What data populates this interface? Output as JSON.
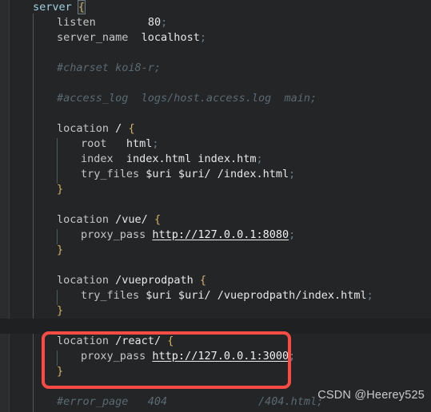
{
  "editor": {
    "background_color": "#232526",
    "highlight_line_color": "#1e2021",
    "comment_color": "#5c6a74",
    "brace_color": "#d4b169",
    "context_color": "#9fd0e0",
    "annotation_box_color": "#fa4b45"
  },
  "code": {
    "language": "nginx",
    "lines": [
      {
        "n": 1,
        "indent": 0,
        "tokens": [
          {
            "t": "ctx",
            "v": "server"
          },
          {
            "t": "sp",
            "v": " "
          },
          {
            "t": "brace-match",
            "v": "{"
          }
        ]
      },
      {
        "n": 2,
        "indent": 1,
        "tokens": [
          {
            "t": "dir",
            "v": "listen"
          },
          {
            "t": "sp",
            "v": "        "
          },
          {
            "t": "val",
            "v": "80"
          },
          {
            "t": "punc",
            "v": ";"
          }
        ]
      },
      {
        "n": 3,
        "indent": 1,
        "tokens": [
          {
            "t": "dir",
            "v": "server_name"
          },
          {
            "t": "sp",
            "v": "  "
          },
          {
            "t": "val",
            "v": "localhost"
          },
          {
            "t": "punc",
            "v": ";"
          }
        ]
      },
      {
        "n": 4,
        "indent": 0,
        "tokens": []
      },
      {
        "n": 5,
        "indent": 1,
        "tokens": [
          {
            "t": "com",
            "v": "#charset koi8-r;"
          }
        ]
      },
      {
        "n": 6,
        "indent": 0,
        "tokens": []
      },
      {
        "n": 7,
        "indent": 1,
        "tokens": [
          {
            "t": "com",
            "v": "#access_log  logs/host.access.log  main;"
          }
        ]
      },
      {
        "n": 8,
        "indent": 0,
        "tokens": []
      },
      {
        "n": 9,
        "indent": 1,
        "tokens": [
          {
            "t": "dir",
            "v": "location"
          },
          {
            "t": "sp",
            "v": " "
          },
          {
            "t": "path",
            "v": "/"
          },
          {
            "t": "sp",
            "v": " "
          },
          {
            "t": "brace",
            "v": "{"
          }
        ]
      },
      {
        "n": 10,
        "indent": 2,
        "tokens": [
          {
            "t": "dir",
            "v": "root"
          },
          {
            "t": "sp",
            "v": "   "
          },
          {
            "t": "val",
            "v": "html"
          },
          {
            "t": "punc",
            "v": ";"
          }
        ]
      },
      {
        "n": 11,
        "indent": 2,
        "tokens": [
          {
            "t": "dir",
            "v": "index"
          },
          {
            "t": "sp",
            "v": "  "
          },
          {
            "t": "val",
            "v": "index.html index.htm"
          },
          {
            "t": "punc",
            "v": ";"
          }
        ]
      },
      {
        "n": 12,
        "indent": 2,
        "tokens": [
          {
            "t": "dir",
            "v": "try_files"
          },
          {
            "t": "sp",
            "v": " "
          },
          {
            "t": "var",
            "v": "$uri $uri/ /index.html"
          },
          {
            "t": "punc",
            "v": ";"
          }
        ]
      },
      {
        "n": 13,
        "indent": 1,
        "tokens": [
          {
            "t": "brace",
            "v": "}"
          }
        ]
      },
      {
        "n": 14,
        "indent": 0,
        "tokens": []
      },
      {
        "n": 15,
        "indent": 1,
        "tokens": [
          {
            "t": "dir",
            "v": "location"
          },
          {
            "t": "sp",
            "v": " "
          },
          {
            "t": "path",
            "v": "/vue/"
          },
          {
            "t": "sp",
            "v": " "
          },
          {
            "t": "brace",
            "v": "{"
          }
        ]
      },
      {
        "n": 16,
        "indent": 2,
        "tokens": [
          {
            "t": "dir",
            "v": "proxy_pass"
          },
          {
            "t": "sp",
            "v": " "
          },
          {
            "t": "url",
            "v": "http://127.0.0.1:8080"
          },
          {
            "t": "punc",
            "v": ";"
          }
        ]
      },
      {
        "n": 17,
        "indent": 1,
        "tokens": [
          {
            "t": "brace",
            "v": "}"
          }
        ]
      },
      {
        "n": 18,
        "indent": 0,
        "tokens": []
      },
      {
        "n": 19,
        "indent": 1,
        "tokens": [
          {
            "t": "dir",
            "v": "location"
          },
          {
            "t": "sp",
            "v": " "
          },
          {
            "t": "path",
            "v": "/vueprodpath"
          },
          {
            "t": "sp",
            "v": " "
          },
          {
            "t": "brace",
            "v": "{"
          }
        ]
      },
      {
        "n": 20,
        "indent": 2,
        "tokens": [
          {
            "t": "dir",
            "v": "try_files"
          },
          {
            "t": "sp",
            "v": " "
          },
          {
            "t": "var",
            "v": "$uri $uri/ /vueprodpath/index.html"
          },
          {
            "t": "punc",
            "v": ";"
          }
        ]
      },
      {
        "n": 21,
        "indent": 1,
        "tokens": [
          {
            "t": "brace",
            "v": "}"
          }
        ]
      },
      {
        "n": 22,
        "indent": 0,
        "tokens": [],
        "highlight": true
      },
      {
        "n": 23,
        "indent": 1,
        "tokens": [
          {
            "t": "dir",
            "v": "location"
          },
          {
            "t": "sp",
            "v": " "
          },
          {
            "t": "path",
            "v": "/react/"
          },
          {
            "t": "sp",
            "v": " "
          },
          {
            "t": "brace",
            "v": "{"
          }
        ]
      },
      {
        "n": 24,
        "indent": 2,
        "tokens": [
          {
            "t": "dir",
            "v": "proxy_pass"
          },
          {
            "t": "sp",
            "v": " "
          },
          {
            "t": "url",
            "v": "http://127.0.0.1:3000"
          },
          {
            "t": "punc",
            "v": ";"
          }
        ]
      },
      {
        "n": 25,
        "indent": 1,
        "tokens": [
          {
            "t": "brace",
            "v": "}"
          }
        ]
      },
      {
        "n": 26,
        "indent": 0,
        "tokens": []
      },
      {
        "n": 27,
        "indent": 1,
        "tokens": [
          {
            "t": "com",
            "v": "#error_page   404              /404.html;"
          }
        ]
      }
    ]
  },
  "annotation": {
    "box_label": "highlighted-react-proxy-block"
  },
  "watermark": {
    "text": "CSDN @Heerey525"
  }
}
